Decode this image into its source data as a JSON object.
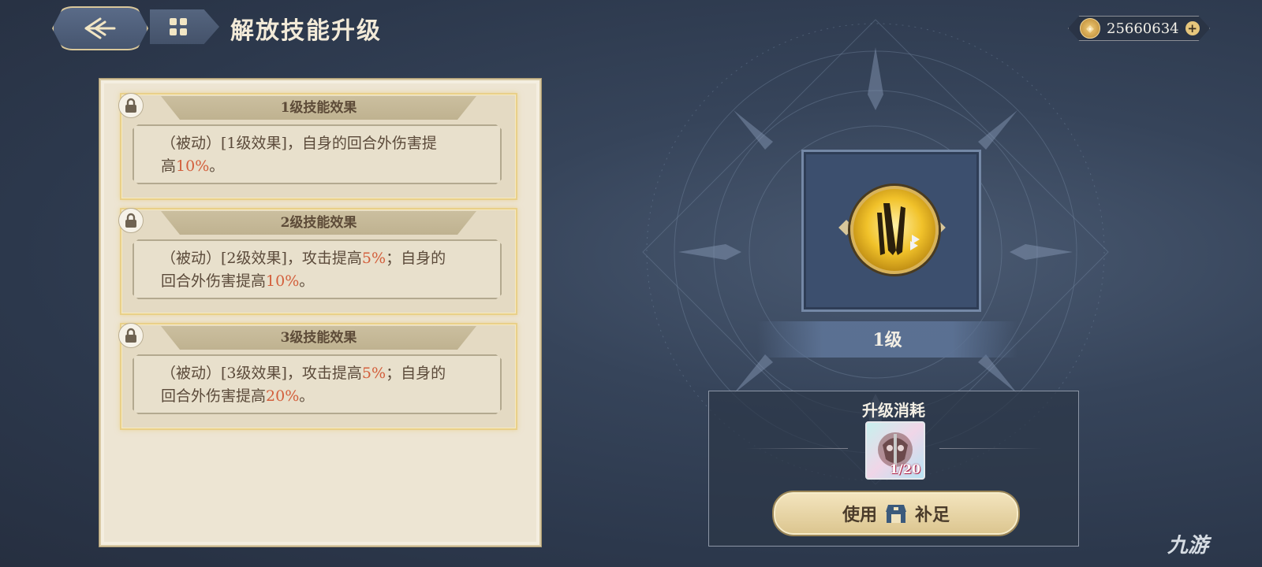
{
  "header": {
    "title": "解放技能升级",
    "currency_value": "25660634",
    "currency_plus": "+"
  },
  "skill_effects": [
    {
      "heading": "1级技能效果",
      "line1": "（被动）[1级效果]，自身的回合外伤害提",
      "line2_prefix": "高",
      "line2_value": "10%",
      "line2_suffix": "。"
    },
    {
      "heading": "2级技能效果",
      "line1_prefix": "（被动）[2级效果]，攻击提高",
      "line1_value": "5%",
      "line1_suffix": "；自身的",
      "line2_prefix": "回合外伤害提高",
      "line2_value": "10%",
      "line2_suffix": "。"
    },
    {
      "heading": "3级技能效果",
      "line1_prefix": "（被动）[3级效果]，攻击提高",
      "line1_value": "5%",
      "line1_suffix": "；自身的",
      "line2_prefix": "回合外伤害提高",
      "line2_value": "20%",
      "line2_suffix": "。"
    }
  ],
  "skill": {
    "level_label": "1级"
  },
  "upgrade_cost": {
    "title": "升级消耗",
    "item_count": "1/20",
    "use_button_prefix": "使用",
    "use_button_suffix": "补足"
  },
  "watermark": "九游",
  "colors": {
    "highlight": "#d35f3c",
    "card_border": "#e9d089",
    "background": "#36445a"
  }
}
